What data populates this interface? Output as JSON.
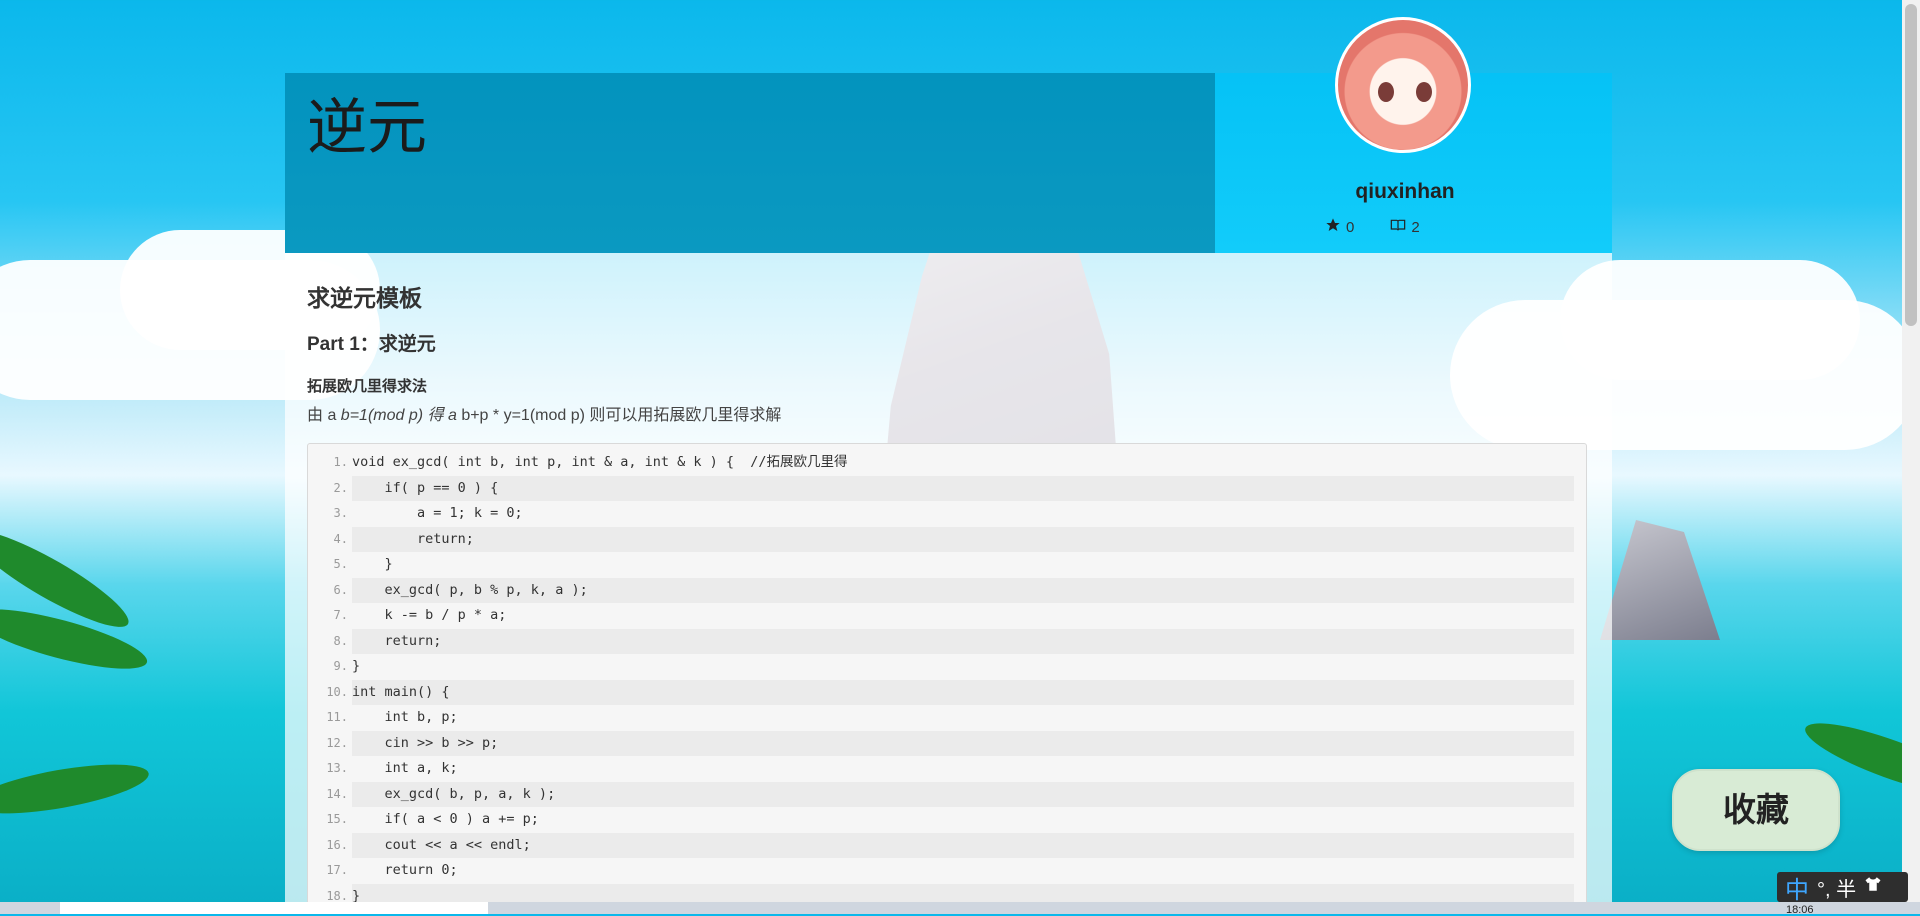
{
  "page": {
    "title": "逆元",
    "author": {
      "username": "qiuxinhan",
      "stars": "0",
      "articles": "2",
      "star_icon": "star-icon",
      "book_icon": "book-icon"
    }
  },
  "article": {
    "heading": "求逆元模板",
    "part1": "Part 1：求逆元",
    "subhead": "拓展欧几里得求法",
    "para_pre": "由 a ",
    "para_italic": "b=1(mod p) 得 a ",
    "para_post": "b+p * y=1(mod p) 则可以用拓展欧几里得求解"
  },
  "code": {
    "lines": [
      {
        "n": "1.",
        "text": "void ex_gcd( int b, int p, int & a, int & k ) {  //拓展欧几里得"
      },
      {
        "n": "2.",
        "text": "    if( p == 0 ) {"
      },
      {
        "n": "3.",
        "text": "        a = 1; k = 0;"
      },
      {
        "n": "4.",
        "text": "        return;"
      },
      {
        "n": "5.",
        "text": "    }"
      },
      {
        "n": "6.",
        "text": "    ex_gcd( p, b % p, k, a );"
      },
      {
        "n": "7.",
        "text": "    k -= b / p * a;"
      },
      {
        "n": "8.",
        "text": "    return;"
      },
      {
        "n": "9.",
        "text": "}"
      },
      {
        "n": "10.",
        "text": "int main() {"
      },
      {
        "n": "11.",
        "text": "    int b, p;"
      },
      {
        "n": "12.",
        "text": "    cin >> b >> p;"
      },
      {
        "n": "13.",
        "text": "    int a, k;"
      },
      {
        "n": "14.",
        "text": "    ex_gcd( b, p, a, k );"
      },
      {
        "n": "15.",
        "text": "    if( a < 0 ) a += p;"
      },
      {
        "n": "16.",
        "text": "    cout << a << endl;"
      },
      {
        "n": "17.",
        "text": "    return 0;"
      },
      {
        "n": "18.",
        "text": "}"
      }
    ]
  },
  "actions": {
    "favorite_label": "收藏"
  },
  "system": {
    "ime_mode": "中",
    "ime_extra": "°, 半",
    "clock": "18:06"
  },
  "colors": {
    "header_bg": "#05c2f6",
    "code_bg": "#f6f6f6",
    "fav_bg": "#d8ebd5"
  }
}
